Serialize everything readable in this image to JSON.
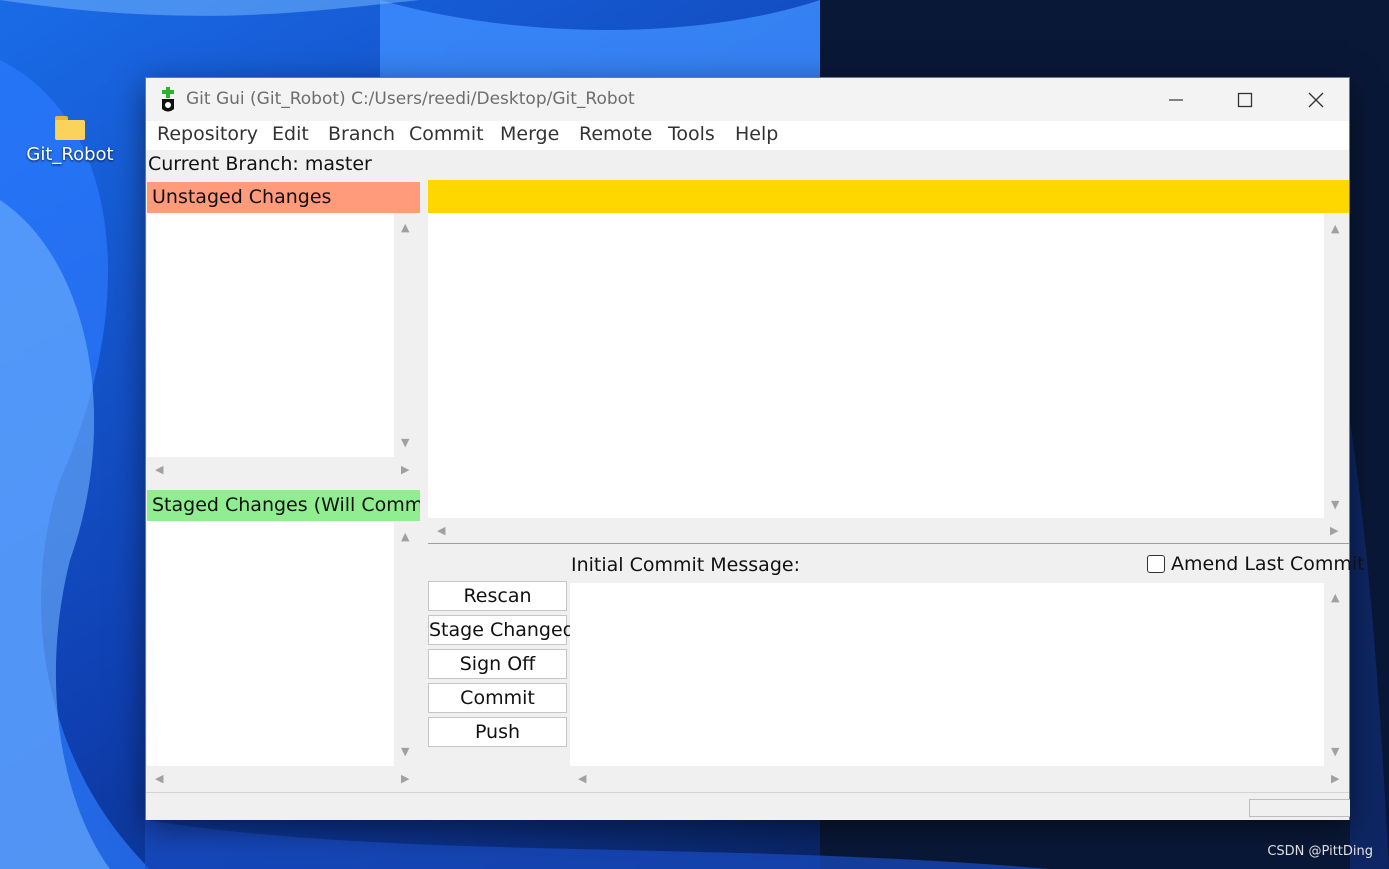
{
  "desktop": {
    "folder_label": "Git_Robot",
    "watermark": "CSDN @PittDing"
  },
  "window": {
    "title": "Git Gui (Git_Robot) C:/Users/reedi/Desktop/Git_Robot",
    "minimize_icon": "minimize-icon",
    "maximize_icon": "maximize-icon",
    "close_icon": "close-icon"
  },
  "menu": [
    "Repository",
    "Edit",
    "Branch",
    "Commit",
    "Merge",
    "Remote",
    "Tools",
    "Help"
  ],
  "branch": {
    "text": "Current Branch: master"
  },
  "unstaged": {
    "header": "Unstaged Changes",
    "color": "#ff9a7a"
  },
  "staged": {
    "header": "Staged Changes (Will Commit)",
    "color": "#90ee90"
  },
  "diff": {
    "header_color": "#ffd700"
  },
  "commit": {
    "label": "Initial Commit Message:",
    "amend_label": "Amend Last Commit",
    "amend_checked": false,
    "buttons": [
      "Rescan",
      "Stage Changed",
      "Sign Off",
      "Commit",
      "Push"
    ]
  }
}
